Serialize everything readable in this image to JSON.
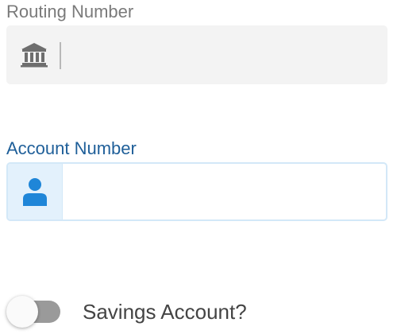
{
  "routing": {
    "label": "Routing Number",
    "value": "",
    "icon": "bank-icon"
  },
  "account": {
    "label": "Account Number",
    "value": "",
    "icon": "person-icon"
  },
  "savings_toggle": {
    "label": "Savings Account?",
    "checked": false
  },
  "colors": {
    "label_default": "#7a7a7a",
    "label_focused": "#1f5f99",
    "icon_default": "#6e6e6e",
    "icon_focused": "#1f86d8",
    "field_background": "#f3f3f3",
    "focused_addon_background": "#e3f1fc",
    "focused_border": "#d3e8f8",
    "toggle_track_off": "#9a9a9a"
  }
}
